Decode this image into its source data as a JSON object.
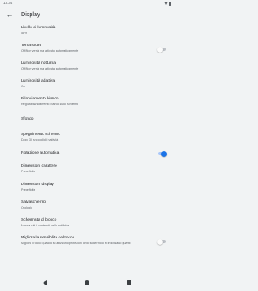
{
  "status_bar": {
    "time": "13:34"
  },
  "app_bar": {
    "title": "Display"
  },
  "settings": [
    {
      "title": "Livello di luminosità",
      "subtitle": "55%"
    },
    {
      "title": "Tema scuro",
      "subtitle": "Off/Non verrà mai attivato automaticamente",
      "toggle": false
    },
    {
      "title": "Luminosità notturna",
      "subtitle": "Off/Non verrà mai attivata automaticamente"
    },
    {
      "title": "Luminosità adattiva",
      "subtitle": "On"
    },
    {
      "title": "Bilanciamento bianco",
      "subtitle": "Regola bilanciamento bianco sullo schermo"
    },
    {
      "title": "Sfondo"
    },
    {
      "title": "Spegnimento schermo",
      "subtitle": "Dopo 30 secondi di inattività"
    },
    {
      "title": "Rotazione automatica",
      "toggle": true
    },
    {
      "title": "Dimensioni carattere",
      "subtitle": "Predefinite"
    },
    {
      "title": "Dimensioni display",
      "subtitle": "Predefinite"
    },
    {
      "title": "Salvaschermo",
      "subtitle": "Orologio"
    },
    {
      "title": "Schermata di blocco",
      "subtitle": "Mostra tutti i contenuti delle notifiche"
    },
    {
      "title": "Migliora la sensibilità del tocco",
      "subtitle": "Migliora il tocco quando si utilizzano protezioni dello schermo o si indossano guanti",
      "toggle": false
    }
  ],
  "colors": {
    "accent": "#1a73e8",
    "background": "#f1f3f4"
  },
  "icons": {
    "back": "arrow-back-icon",
    "nav_back": "nav-back-icon",
    "nav_home": "nav-home-icon",
    "nav_recents": "nav-recents-icon"
  }
}
